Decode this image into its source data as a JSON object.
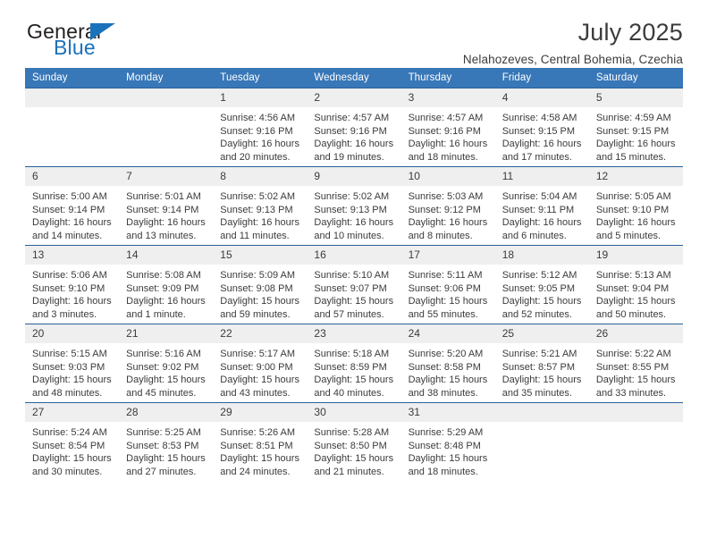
{
  "brand": {
    "name_primary": "General",
    "name_secondary": "Blue",
    "accent_color": "#1a72bb"
  },
  "header": {
    "title": "July 2025",
    "subtitle": "Nelahozeves, Central Bohemia, Czechia"
  },
  "calendar": {
    "header_bg": "#3877b8",
    "weekdays": [
      "Sunday",
      "Monday",
      "Tuesday",
      "Wednesday",
      "Thursday",
      "Friday",
      "Saturday"
    ],
    "weeks": [
      [
        {
          "day": "",
          "empty": true
        },
        {
          "day": "",
          "empty": true
        },
        {
          "day": "1",
          "sunrise": "Sunrise: 4:56 AM",
          "sunset": "Sunset: 9:16 PM",
          "daylight": "Daylight: 16 hours and 20 minutes."
        },
        {
          "day": "2",
          "sunrise": "Sunrise: 4:57 AM",
          "sunset": "Sunset: 9:16 PM",
          "daylight": "Daylight: 16 hours and 19 minutes."
        },
        {
          "day": "3",
          "sunrise": "Sunrise: 4:57 AM",
          "sunset": "Sunset: 9:16 PM",
          "daylight": "Daylight: 16 hours and 18 minutes."
        },
        {
          "day": "4",
          "sunrise": "Sunrise: 4:58 AM",
          "sunset": "Sunset: 9:15 PM",
          "daylight": "Daylight: 16 hours and 17 minutes."
        },
        {
          "day": "5",
          "sunrise": "Sunrise: 4:59 AM",
          "sunset": "Sunset: 9:15 PM",
          "daylight": "Daylight: 16 hours and 15 minutes."
        }
      ],
      [
        {
          "day": "6",
          "sunrise": "Sunrise: 5:00 AM",
          "sunset": "Sunset: 9:14 PM",
          "daylight": "Daylight: 16 hours and 14 minutes."
        },
        {
          "day": "7",
          "sunrise": "Sunrise: 5:01 AM",
          "sunset": "Sunset: 9:14 PM",
          "daylight": "Daylight: 16 hours and 13 minutes."
        },
        {
          "day": "8",
          "sunrise": "Sunrise: 5:02 AM",
          "sunset": "Sunset: 9:13 PM",
          "daylight": "Daylight: 16 hours and 11 minutes."
        },
        {
          "day": "9",
          "sunrise": "Sunrise: 5:02 AM",
          "sunset": "Sunset: 9:13 PM",
          "daylight": "Daylight: 16 hours and 10 minutes."
        },
        {
          "day": "10",
          "sunrise": "Sunrise: 5:03 AM",
          "sunset": "Sunset: 9:12 PM",
          "daylight": "Daylight: 16 hours and 8 minutes."
        },
        {
          "day": "11",
          "sunrise": "Sunrise: 5:04 AM",
          "sunset": "Sunset: 9:11 PM",
          "daylight": "Daylight: 16 hours and 6 minutes."
        },
        {
          "day": "12",
          "sunrise": "Sunrise: 5:05 AM",
          "sunset": "Sunset: 9:10 PM",
          "daylight": "Daylight: 16 hours and 5 minutes."
        }
      ],
      [
        {
          "day": "13",
          "sunrise": "Sunrise: 5:06 AM",
          "sunset": "Sunset: 9:10 PM",
          "daylight": "Daylight: 16 hours and 3 minutes."
        },
        {
          "day": "14",
          "sunrise": "Sunrise: 5:08 AM",
          "sunset": "Sunset: 9:09 PM",
          "daylight": "Daylight: 16 hours and 1 minute."
        },
        {
          "day": "15",
          "sunrise": "Sunrise: 5:09 AM",
          "sunset": "Sunset: 9:08 PM",
          "daylight": "Daylight: 15 hours and 59 minutes."
        },
        {
          "day": "16",
          "sunrise": "Sunrise: 5:10 AM",
          "sunset": "Sunset: 9:07 PM",
          "daylight": "Daylight: 15 hours and 57 minutes."
        },
        {
          "day": "17",
          "sunrise": "Sunrise: 5:11 AM",
          "sunset": "Sunset: 9:06 PM",
          "daylight": "Daylight: 15 hours and 55 minutes."
        },
        {
          "day": "18",
          "sunrise": "Sunrise: 5:12 AM",
          "sunset": "Sunset: 9:05 PM",
          "daylight": "Daylight: 15 hours and 52 minutes."
        },
        {
          "day": "19",
          "sunrise": "Sunrise: 5:13 AM",
          "sunset": "Sunset: 9:04 PM",
          "daylight": "Daylight: 15 hours and 50 minutes."
        }
      ],
      [
        {
          "day": "20",
          "sunrise": "Sunrise: 5:15 AM",
          "sunset": "Sunset: 9:03 PM",
          "daylight": "Daylight: 15 hours and 48 minutes."
        },
        {
          "day": "21",
          "sunrise": "Sunrise: 5:16 AM",
          "sunset": "Sunset: 9:02 PM",
          "daylight": "Daylight: 15 hours and 45 minutes."
        },
        {
          "day": "22",
          "sunrise": "Sunrise: 5:17 AM",
          "sunset": "Sunset: 9:00 PM",
          "daylight": "Daylight: 15 hours and 43 minutes."
        },
        {
          "day": "23",
          "sunrise": "Sunrise: 5:18 AM",
          "sunset": "Sunset: 8:59 PM",
          "daylight": "Daylight: 15 hours and 40 minutes."
        },
        {
          "day": "24",
          "sunrise": "Sunrise: 5:20 AM",
          "sunset": "Sunset: 8:58 PM",
          "daylight": "Daylight: 15 hours and 38 minutes."
        },
        {
          "day": "25",
          "sunrise": "Sunrise: 5:21 AM",
          "sunset": "Sunset: 8:57 PM",
          "daylight": "Daylight: 15 hours and 35 minutes."
        },
        {
          "day": "26",
          "sunrise": "Sunrise: 5:22 AM",
          "sunset": "Sunset: 8:55 PM",
          "daylight": "Daylight: 15 hours and 33 minutes."
        }
      ],
      [
        {
          "day": "27",
          "sunrise": "Sunrise: 5:24 AM",
          "sunset": "Sunset: 8:54 PM",
          "daylight": "Daylight: 15 hours and 30 minutes."
        },
        {
          "day": "28",
          "sunrise": "Sunrise: 5:25 AM",
          "sunset": "Sunset: 8:53 PM",
          "daylight": "Daylight: 15 hours and 27 minutes."
        },
        {
          "day": "29",
          "sunrise": "Sunrise: 5:26 AM",
          "sunset": "Sunset: 8:51 PM",
          "daylight": "Daylight: 15 hours and 24 minutes."
        },
        {
          "day": "30",
          "sunrise": "Sunrise: 5:28 AM",
          "sunset": "Sunset: 8:50 PM",
          "daylight": "Daylight: 15 hours and 21 minutes."
        },
        {
          "day": "31",
          "sunrise": "Sunrise: 5:29 AM",
          "sunset": "Sunset: 8:48 PM",
          "daylight": "Daylight: 15 hours and 18 minutes."
        },
        {
          "day": "",
          "empty": true
        },
        {
          "day": "",
          "empty": true
        }
      ]
    ]
  }
}
